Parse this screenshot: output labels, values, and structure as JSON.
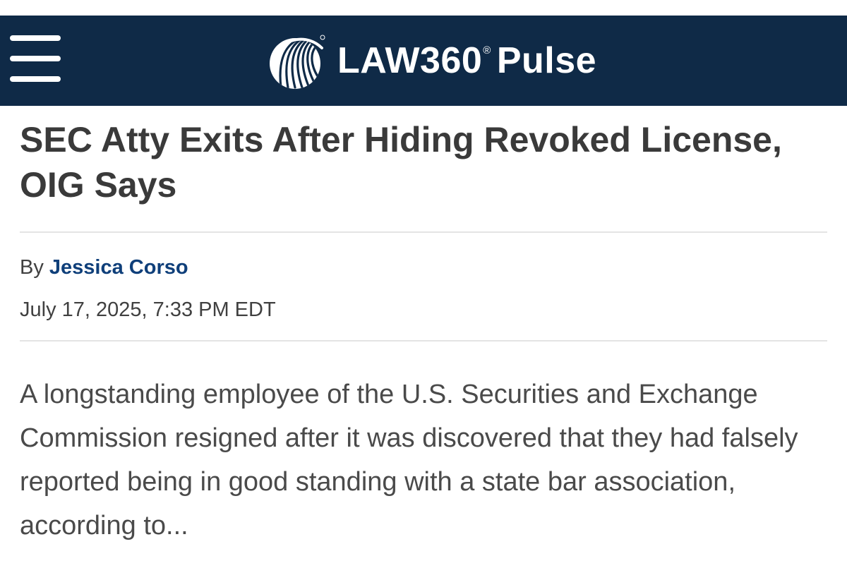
{
  "header": {
    "brand_name": "LAW360",
    "brand_registered": "®",
    "brand_suffix": "Pulse",
    "background_color": "#0f2a47",
    "menu_icon": "hamburger-icon",
    "logo_icon": "globe-logo-icon"
  },
  "article": {
    "headline": "SEC Atty Exits After Hiding Revoked License, OIG Says",
    "byline_prefix": "By",
    "author": "Jessica Corso",
    "author_color": "#0f3f7a",
    "dateline": "July 17, 2025, 7:33 PM EDT",
    "summary": "A longstanding employee of the U.S. Securities and Exchange Commission resigned after it was discovered that they had falsely reported being in good standing with a state bar association, according to..."
  }
}
